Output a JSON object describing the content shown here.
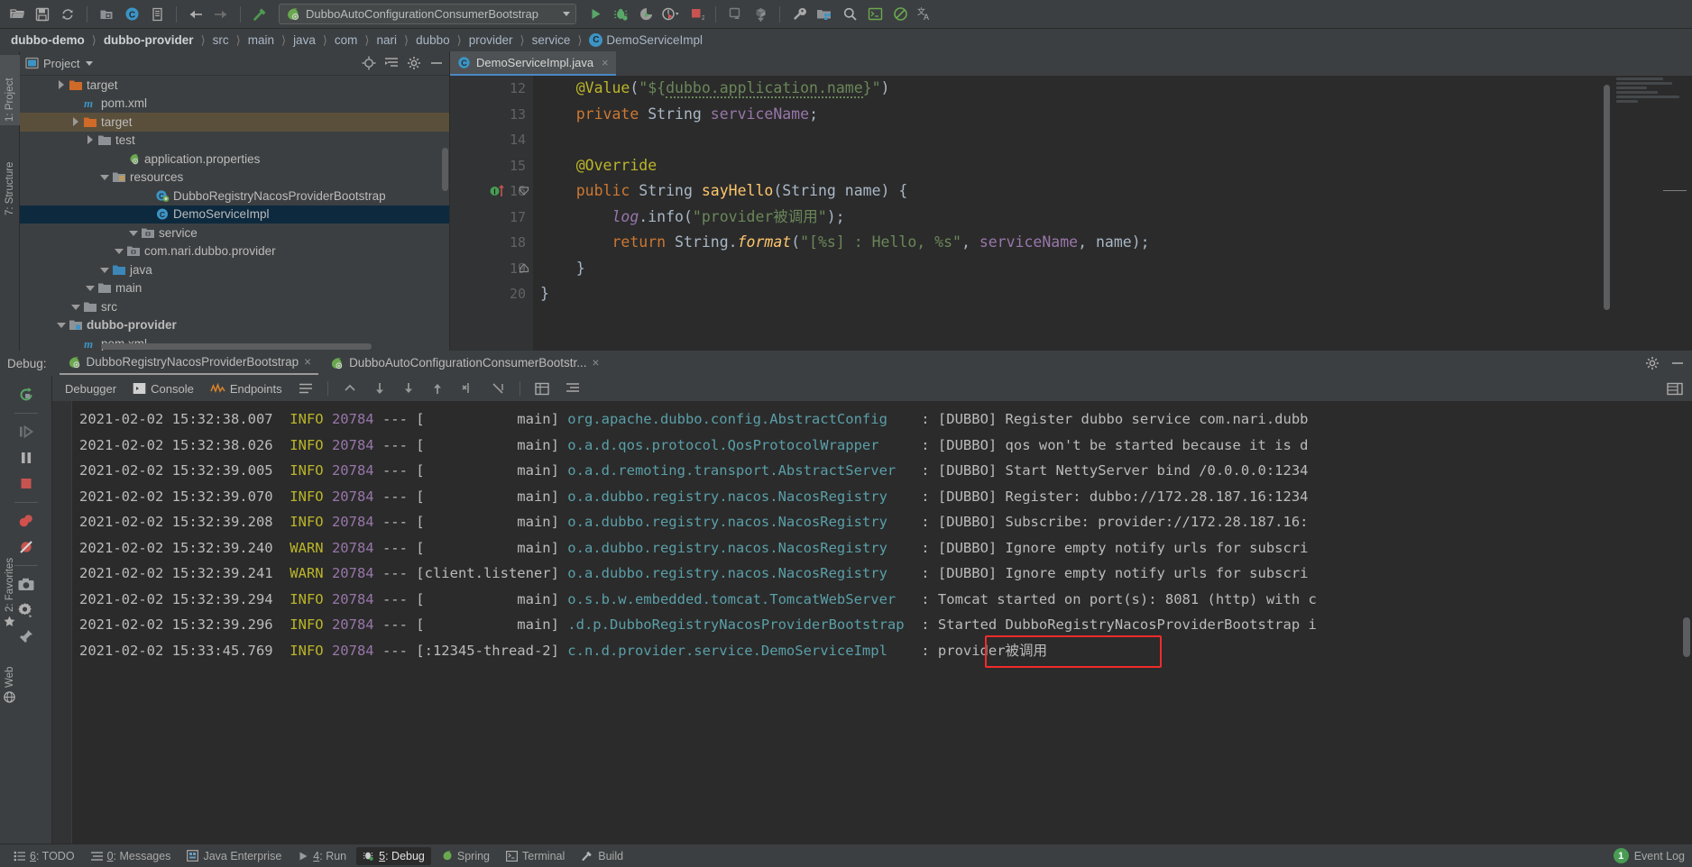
{
  "toolbar": {
    "icons": [
      "open-folder-icon",
      "save-all-icon",
      "sync-icon",
      "new-folder-icon",
      "compile-icon",
      "copy-document-icon",
      "back-arrow-icon",
      "forward-arrow-icon",
      "build-hammer-icon"
    ],
    "run_config": {
      "name": "DubboAutoConfigurationConsumerBootstrap",
      "icon": "spring-boot-icon"
    },
    "right_icons": [
      "run-icon",
      "debug-icon",
      "run-with-coverage-icon",
      "profiler-icon",
      "stop-icon",
      "android-device-icon",
      "sync-gradle-icon",
      "wrench-settings-icon",
      "project-structure-icon",
      "search-everywhere-icon",
      "terminal-green-icon",
      "no-entry-icon",
      "translate-icon"
    ]
  },
  "breadcrumbs": [
    {
      "label": "dubbo-demo",
      "bold": true,
      "icon": ""
    },
    {
      "label": "dubbo-provider",
      "bold": true,
      "icon": ""
    },
    {
      "label": "src",
      "bold": false,
      "icon": ""
    },
    {
      "label": "main",
      "bold": false,
      "icon": ""
    },
    {
      "label": "java",
      "bold": false,
      "icon": ""
    },
    {
      "label": "com",
      "bold": false,
      "icon": ""
    },
    {
      "label": "nari",
      "bold": false,
      "icon": ""
    },
    {
      "label": "dubbo",
      "bold": false,
      "icon": ""
    },
    {
      "label": "provider",
      "bold": false,
      "icon": ""
    },
    {
      "label": "service",
      "bold": false,
      "icon": ""
    },
    {
      "label": "DemoServiceImpl",
      "bold": false,
      "icon": "class-icon"
    }
  ],
  "left_strip": [
    {
      "label": "1: Project",
      "selected": true,
      "icon": "project-icon"
    },
    {
      "label": "7: Structure",
      "selected": false,
      "icon": "structure-icon"
    }
  ],
  "left_strip_bottom": [
    {
      "label": "2: Favorites",
      "icon": "star-icon"
    },
    {
      "label": "Web",
      "icon": "web-icon"
    }
  ],
  "project_panel": {
    "title": "Project",
    "header_icons": [
      "target-locate-icon",
      "collapse-all-icon",
      "gear-icon",
      "hide-icon"
    ],
    "tree": [
      {
        "label": "pom.xml",
        "indent": 3,
        "arrow": "none",
        "icon": "maven-icon",
        "state": "normal",
        "bold": false
      },
      {
        "label": "dubbo-provider",
        "indent": 2,
        "arrow": "down",
        "icon": "module-icon",
        "state": "normal",
        "bold": true
      },
      {
        "label": "src",
        "indent": 3,
        "arrow": "down",
        "icon": "folder-icon",
        "state": "normal",
        "bold": false
      },
      {
        "label": "main",
        "indent": 4,
        "arrow": "down",
        "icon": "folder-icon",
        "state": "normal",
        "bold": false
      },
      {
        "label": "java",
        "indent": 5,
        "arrow": "down",
        "icon": "source-folder-icon",
        "state": "normal",
        "bold": false
      },
      {
        "label": "com.nari.dubbo.provider",
        "indent": 6,
        "arrow": "down",
        "icon": "package-icon",
        "state": "normal",
        "bold": false
      },
      {
        "label": "service",
        "indent": 7,
        "arrow": "down",
        "icon": "package-icon",
        "state": "normal",
        "bold": false
      },
      {
        "label": "DemoServiceImpl",
        "indent": 8,
        "arrow": "none",
        "icon": "class-icon",
        "state": "selected",
        "bold": false
      },
      {
        "label": "DubboRegistryNacosProviderBootstrap",
        "indent": 8,
        "arrow": "none",
        "icon": "spring-class-icon",
        "state": "normal",
        "bold": false
      },
      {
        "label": "resources",
        "indent": 5,
        "arrow": "down",
        "icon": "resources-folder-icon",
        "state": "normal",
        "bold": false
      },
      {
        "label": "application.properties",
        "indent": 6,
        "arrow": "none",
        "icon": "spring-properties-icon",
        "state": "normal",
        "bold": false
      },
      {
        "label": "test",
        "indent": 4,
        "arrow": "right",
        "icon": "folder-icon",
        "state": "normal",
        "bold": false
      },
      {
        "label": "target",
        "indent": 3,
        "arrow": "right",
        "icon": "target-folder-icon",
        "state": "highlighted",
        "bold": false
      },
      {
        "label": "pom.xml",
        "indent": 3,
        "arrow": "none",
        "icon": "maven-icon",
        "state": "normal",
        "bold": false
      },
      {
        "label": "target",
        "indent": 2,
        "arrow": "right",
        "icon": "target-folder-icon",
        "state": "normal",
        "bold": false
      }
    ]
  },
  "editor": {
    "tab": {
      "label": "DemoServiceImpl.java",
      "icon": "class-icon",
      "close": "×"
    },
    "lines": [
      {
        "no": "12",
        "marker": "",
        "fold": "",
        "segments": [
          {
            "t": "    ",
            "c": ""
          },
          {
            "t": "@Value",
            "c": "anno"
          },
          {
            "t": "(",
            "c": "typ"
          },
          {
            "t": "\"${",
            "c": "str"
          },
          {
            "t": "dubbo.application.name",
            "c": "str squig"
          },
          {
            "t": "}\"",
            "c": "str"
          },
          {
            "t": ")",
            "c": "typ"
          }
        ]
      },
      {
        "no": "13",
        "marker": "",
        "fold": "",
        "segments": [
          {
            "t": "    ",
            "c": ""
          },
          {
            "t": "private ",
            "c": "kw"
          },
          {
            "t": "String ",
            "c": "typ"
          },
          {
            "t": "serviceName",
            "c": "fld"
          },
          {
            "t": ";",
            "c": "typ"
          }
        ]
      },
      {
        "no": "14",
        "marker": "",
        "fold": "",
        "segments": []
      },
      {
        "no": "15",
        "marker": "",
        "fold": "",
        "segments": [
          {
            "t": "    ",
            "c": ""
          },
          {
            "t": "@Override",
            "c": "anno"
          }
        ]
      },
      {
        "no": "16",
        "marker": "implemented-method-icon",
        "fold": "fold-end",
        "segments": [
          {
            "t": "    ",
            "c": ""
          },
          {
            "t": "public ",
            "c": "kw"
          },
          {
            "t": "String ",
            "c": "typ"
          },
          {
            "t": "sayHello",
            "c": "mth"
          },
          {
            "t": "(String name) {",
            "c": "typ"
          }
        ]
      },
      {
        "no": "17",
        "marker": "",
        "fold": "",
        "segments": [
          {
            "t": "        ",
            "c": ""
          },
          {
            "t": "log",
            "c": "stat"
          },
          {
            "t": ".info(",
            "c": "typ"
          },
          {
            "t": "\"provider被调用\"",
            "c": "str"
          },
          {
            "t": ");",
            "c": "typ"
          }
        ]
      },
      {
        "no": "18",
        "marker": "",
        "fold": "",
        "segments": [
          {
            "t": "        ",
            "c": ""
          },
          {
            "t": "return ",
            "c": "kw"
          },
          {
            "t": "String.",
            "c": "typ"
          },
          {
            "t": "format",
            "c": "mthi"
          },
          {
            "t": "(",
            "c": "typ"
          },
          {
            "t": "\"[%s] : Hello, %s\"",
            "c": "str"
          },
          {
            "t": ", ",
            "c": "typ"
          },
          {
            "t": "serviceName",
            "c": "fld"
          },
          {
            "t": ", name);",
            "c": "typ"
          }
        ]
      },
      {
        "no": "19",
        "marker": "",
        "fold": "fold-close",
        "segments": [
          {
            "t": "    }",
            "c": "typ"
          }
        ]
      },
      {
        "no": "20",
        "marker": "",
        "fold": "",
        "segments": [
          {
            "t": "}",
            "c": "typ"
          }
        ]
      }
    ]
  },
  "debug": {
    "label": "Debug:",
    "tabs": [
      {
        "label": "DubboRegistryNacosProviderBootstrap",
        "icon": "spring-boot-icon",
        "active": true,
        "close": "×"
      },
      {
        "label": "DubboAutoConfigurationConsumerBootstr...",
        "icon": "spring-boot-icon",
        "active": false,
        "close": "×"
      }
    ],
    "header_right_icons": [
      "gear-icon",
      "hide-icon"
    ],
    "side_icons": [
      "rerun-icon",
      "resume-program-icon",
      "pause-program-icon",
      "stop-icon",
      "mute-breakpoints-icon",
      "view-breakpoints-icon",
      "screenshot-icon",
      "settings-icon",
      "pin-tab-icon"
    ],
    "toolbar_tabs": [
      {
        "label": "Debugger",
        "icon": "",
        "active": false
      },
      {
        "label": "Console",
        "icon": "console-icon",
        "active": false
      },
      {
        "label": "Endpoints",
        "icon": "endpoints-icon",
        "active": false
      }
    ],
    "toolbar_icons": [
      "soft-wrap-icon",
      "scroll-to-top-icon",
      "scroll-down-icon",
      "scroll-to-end-icon",
      "scroll-up-icon",
      "print-icon",
      "clear-all-icon",
      "table-icon",
      "list-icon"
    ],
    "toolbar_right_icon": "layout-settings-icon"
  },
  "console_lines": [
    {
      "ts": "2021-02-02 15:32:38.007",
      "level": "INFO",
      "pid": "20784",
      "thread": "main",
      "logger": "org.apache.dubbo.config.AbstractConfig",
      "sep": ":",
      "msg": "[DUBBO] Register dubbo service com.nari.dubb"
    },
    {
      "ts": "2021-02-02 15:32:38.026",
      "level": "INFO",
      "pid": "20784",
      "thread": "main",
      "logger": "o.a.d.qos.protocol.QosProtocolWrapper",
      "sep": ":",
      "msg": "[DUBBO] qos won't be started because it is d"
    },
    {
      "ts": "2021-02-02 15:32:39.005",
      "level": "INFO",
      "pid": "20784",
      "thread": "main",
      "logger": "o.a.d.remoting.transport.AbstractServer",
      "sep": ":",
      "msg": "[DUBBO] Start NettyServer bind /0.0.0.0:1234"
    },
    {
      "ts": "2021-02-02 15:32:39.070",
      "level": "INFO",
      "pid": "20784",
      "thread": "main",
      "logger": "o.a.dubbo.registry.nacos.NacosRegistry",
      "sep": ":",
      "msg": "[DUBBO] Register: dubbo://172.28.187.16:1234"
    },
    {
      "ts": "2021-02-02 15:32:39.208",
      "level": "INFO",
      "pid": "20784",
      "thread": "main",
      "logger": "o.a.dubbo.registry.nacos.NacosRegistry",
      "sep": ":",
      "msg": "[DUBBO] Subscribe: provider://172.28.187.16:"
    },
    {
      "ts": "2021-02-02 15:32:39.240",
      "level": "WARN",
      "pid": "20784",
      "thread": "main",
      "logger": "o.a.dubbo.registry.nacos.NacosRegistry",
      "sep": ":",
      "msg": "[DUBBO] Ignore empty notify urls for subscri"
    },
    {
      "ts": "2021-02-02 15:32:39.241",
      "level": "WARN",
      "pid": "20784",
      "thread": "client.listener",
      "logger": "o.a.dubbo.registry.nacos.NacosRegistry",
      "sep": ":",
      "msg": "[DUBBO] Ignore empty notify urls for subscri"
    },
    {
      "ts": "2021-02-02 15:32:39.294",
      "level": "INFO",
      "pid": "20784",
      "thread": "main",
      "logger": "o.s.b.w.embedded.tomcat.TomcatWebServer",
      "sep": ":",
      "msg": "Tomcat started on port(s): 8081 (http) with c"
    },
    {
      "ts": "2021-02-02 15:32:39.296",
      "level": "INFO",
      "pid": "20784",
      "thread": "main",
      "logger": ".d.p.DubboRegistryNacosProviderBootstrap",
      "sep": ":",
      "msg": "Started DubboRegistryNacosProviderBootstrap i"
    },
    {
      "ts": "2021-02-02 15:33:45.769",
      "level": "INFO",
      "pid": "20784",
      "thread": ":12345-thread-2",
      "logger": "c.n.d.provider.service.DemoServiceImpl",
      "sep": ":",
      "msg": "provider被调用",
      "highlight": true
    }
  ],
  "status_bar": {
    "items": [
      {
        "num": "6",
        "label": ": TODO",
        "icon": "todo-icon",
        "active": false
      },
      {
        "num": "0",
        "label": ": Messages",
        "icon": "messages-icon",
        "active": false
      },
      {
        "num": "",
        "label": "Java Enterprise",
        "icon": "java-enterprise-icon",
        "active": false
      },
      {
        "num": "4",
        "label": ": Run",
        "icon": "run-icon",
        "active": false
      },
      {
        "num": "5",
        "label": ": Debug",
        "icon": "debug-icon",
        "active": true
      },
      {
        "num": "",
        "label": "Spring",
        "icon": "spring-icon",
        "active": false
      },
      {
        "num": "",
        "label": "Terminal",
        "icon": "terminal-icon",
        "active": false
      },
      {
        "num": "",
        "label": "Build",
        "icon": "build-icon",
        "active": false
      }
    ],
    "event_log": {
      "count": "1",
      "label": "Event Log"
    }
  },
  "colors": {
    "bg": "#3c3f41",
    "editor_bg": "#2b2b2b",
    "selection": "#0d293e",
    "highlight_row": "#5a4f3a",
    "accent": "#4a88c7",
    "red_box": "#f12b2b",
    "green": "#499c54"
  }
}
